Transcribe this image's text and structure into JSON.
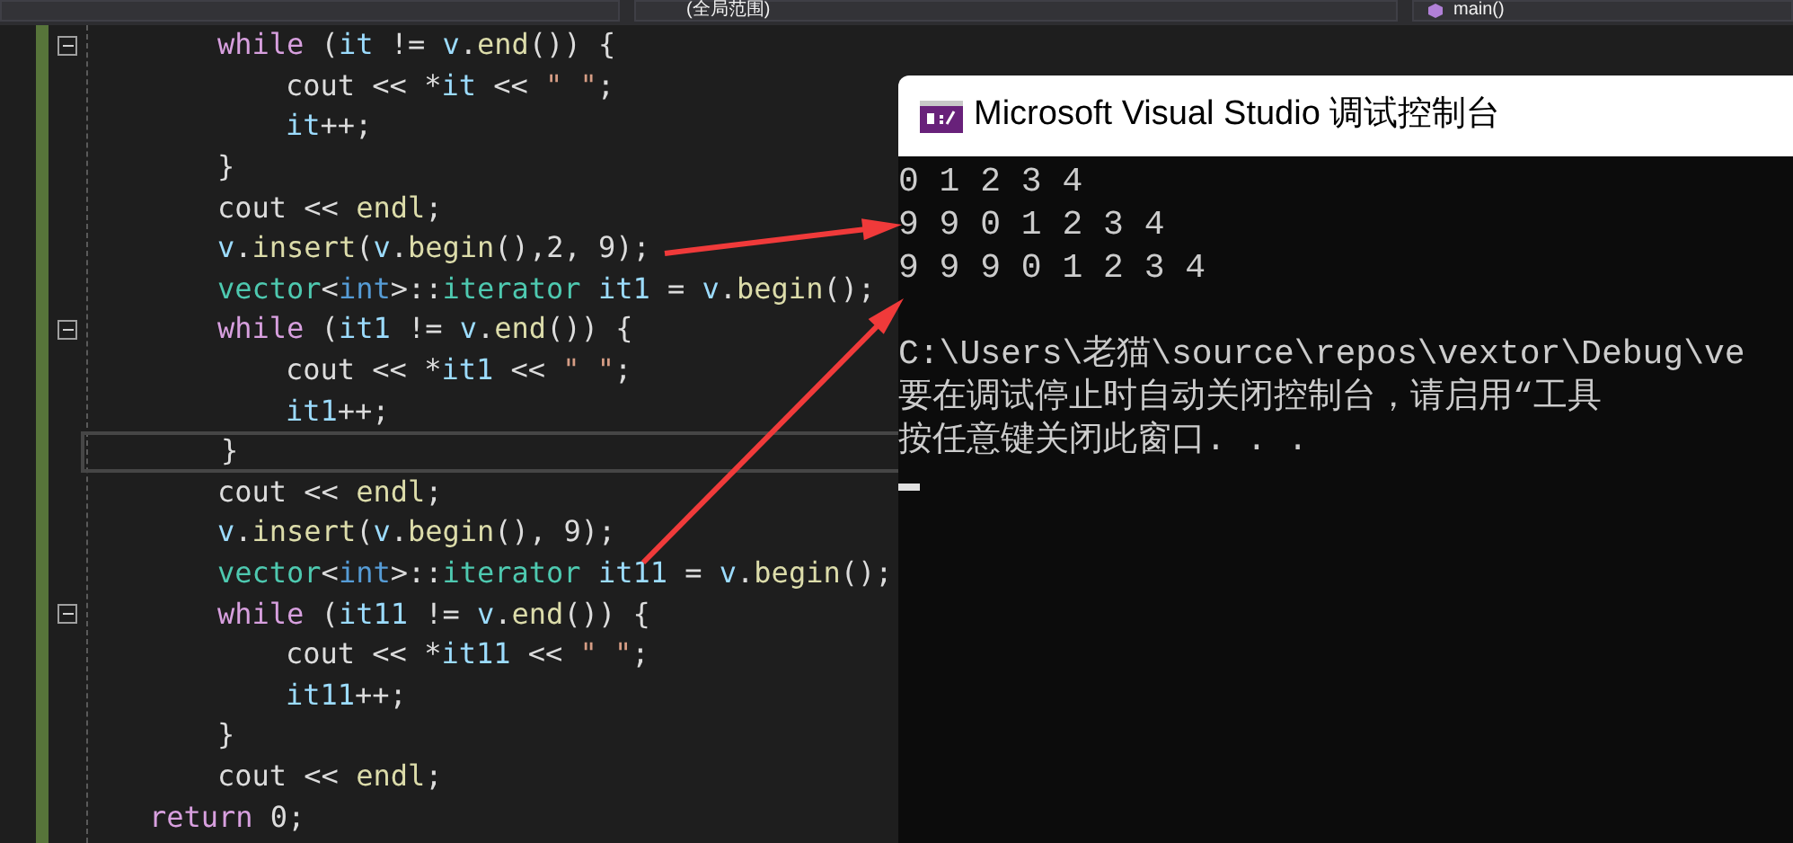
{
  "toolbar": {
    "scope_dropdown": "(全局范围)",
    "member_dropdown": "main()"
  },
  "code": {
    "lines": [
      {
        "children": [
          {
            "fold": true,
            "tokens": [
              {
                "kind": "keyword",
                "text": "while"
              },
              {
                "kind": "plain",
                "text": " ("
              },
              {
                "kind": "variable",
                "text": "it"
              },
              {
                "kind": "plain",
                "text": " != "
              },
              {
                "kind": "variable",
                "text": "v"
              },
              {
                "kind": "plain",
                "text": "."
              },
              {
                "kind": "function",
                "text": "end"
              },
              {
                "kind": "plain",
                "text": "()) {"
              }
            ],
            "children": [
              {
                "tokens": [
                  {
                    "kind": "plain",
                    "text": "cout << *"
                  },
                  {
                    "kind": "variable",
                    "text": "it"
                  },
                  {
                    "kind": "plain",
                    "text": " << "
                  },
                  {
                    "kind": "string",
                    "text": "\" \""
                  },
                  {
                    "kind": "plain",
                    "text": ";"
                  }
                ]
              },
              {
                "tokens": [
                  {
                    "kind": "variable",
                    "text": "it"
                  },
                  {
                    "kind": "plain",
                    "text": "++;"
                  }
                ]
              }
            ]
          },
          {
            "tokens": [
              {
                "kind": "plain",
                "text": "}"
              }
            ]
          },
          {
            "tokens": [
              {
                "kind": "plain",
                "text": "cout << "
              },
              {
                "kind": "function",
                "text": "endl"
              },
              {
                "kind": "plain",
                "text": ";"
              }
            ]
          },
          {
            "tokens": [
              {
                "kind": "variable",
                "text": "v"
              },
              {
                "kind": "plain",
                "text": "."
              },
              {
                "kind": "function",
                "text": "insert"
              },
              {
                "kind": "plain",
                "text": "("
              },
              {
                "kind": "variable",
                "text": "v"
              },
              {
                "kind": "plain",
                "text": "."
              },
              {
                "kind": "function",
                "text": "begin"
              },
              {
                "kind": "plain",
                "text": "(),2, 9);"
              }
            ]
          },
          {
            "tokens": [
              {
                "kind": "type",
                "text": "vector"
              },
              {
                "kind": "plain",
                "text": "<"
              },
              {
                "kind": "builtin",
                "text": "int"
              },
              {
                "kind": "plain",
                "text": ">::"
              },
              {
                "kind": "type",
                "text": "iterator"
              },
              {
                "kind": "variable",
                "text": " it1"
              },
              {
                "kind": "plain",
                "text": " = "
              },
              {
                "kind": "variable",
                "text": "v"
              },
              {
                "kind": "plain",
                "text": "."
              },
              {
                "kind": "function",
                "text": "begin"
              },
              {
                "kind": "plain",
                "text": "();"
              }
            ]
          },
          {
            "fold": true,
            "tokens": [
              {
                "kind": "keyword",
                "text": "while"
              },
              {
                "kind": "plain",
                "text": " ("
              },
              {
                "kind": "variable",
                "text": "it1"
              },
              {
                "kind": "plain",
                "text": " != "
              },
              {
                "kind": "variable",
                "text": "v"
              },
              {
                "kind": "plain",
                "text": "."
              },
              {
                "kind": "function",
                "text": "end"
              },
              {
                "kind": "plain",
                "text": "()) {"
              }
            ],
            "children": [
              {
                "tokens": [
                  {
                    "kind": "plain",
                    "text": "cout << *"
                  },
                  {
                    "kind": "variable",
                    "text": "it1"
                  },
                  {
                    "kind": "plain",
                    "text": " << "
                  },
                  {
                    "kind": "string",
                    "text": "\" \""
                  },
                  {
                    "kind": "plain",
                    "text": ";"
                  }
                ]
              },
              {
                "tokens": [
                  {
                    "kind": "variable",
                    "text": "it1"
                  },
                  {
                    "kind": "plain",
                    "text": "++;"
                  }
                ]
              }
            ]
          },
          {
            "current": true,
            "tokens": [
              {
                "kind": "plain",
                "text": "}"
              }
            ]
          },
          {
            "tokens": [
              {
                "kind": "plain",
                "text": "cout << "
              },
              {
                "kind": "function",
                "text": "endl"
              },
              {
                "kind": "plain",
                "text": ";"
              }
            ]
          },
          {
            "tokens": [
              {
                "kind": "variable",
                "text": "v"
              },
              {
                "kind": "plain",
                "text": "."
              },
              {
                "kind": "function",
                "text": "insert"
              },
              {
                "kind": "plain",
                "text": "("
              },
              {
                "kind": "variable",
                "text": "v"
              },
              {
                "kind": "plain",
                "text": "."
              },
              {
                "kind": "function",
                "text": "begin"
              },
              {
                "kind": "plain",
                "text": "(), 9);"
              }
            ]
          },
          {
            "tokens": [
              {
                "kind": "type",
                "text": "vector"
              },
              {
                "kind": "plain",
                "text": "<"
              },
              {
                "kind": "builtin",
                "text": "int"
              },
              {
                "kind": "plain",
                "text": ">::"
              },
              {
                "kind": "type",
                "text": "iterator"
              },
              {
                "kind": "variable",
                "text": " it11"
              },
              {
                "kind": "plain",
                "text": " = "
              },
              {
                "kind": "variable",
                "text": "v"
              },
              {
                "kind": "plain",
                "text": "."
              },
              {
                "kind": "function",
                "text": "begin"
              },
              {
                "kind": "plain",
                "text": "();"
              }
            ]
          },
          {
            "fold": true,
            "tokens": [
              {
                "kind": "keyword",
                "text": "while"
              },
              {
                "kind": "plain",
                "text": " ("
              },
              {
                "kind": "variable",
                "text": "it11"
              },
              {
                "kind": "plain",
                "text": " != "
              },
              {
                "kind": "variable",
                "text": "v"
              },
              {
                "kind": "plain",
                "text": "."
              },
              {
                "kind": "function",
                "text": "end"
              },
              {
                "kind": "plain",
                "text": "()) {"
              }
            ],
            "children": [
              {
                "tokens": [
                  {
                    "kind": "plain",
                    "text": "cout << *"
                  },
                  {
                    "kind": "variable",
                    "text": "it11"
                  },
                  {
                    "kind": "plain",
                    "text": " << "
                  },
                  {
                    "kind": "string",
                    "text": "\" \""
                  },
                  {
                    "kind": "plain",
                    "text": ";"
                  }
                ]
              },
              {
                "tokens": [
                  {
                    "kind": "variable",
                    "text": "it11"
                  },
                  {
                    "kind": "plain",
                    "text": "++;"
                  }
                ]
              }
            ]
          },
          {
            "tokens": [
              {
                "kind": "plain",
                "text": "}"
              }
            ]
          },
          {
            "tokens": [
              {
                "kind": "plain",
                "text": "cout << "
              },
              {
                "kind": "function",
                "text": "endl"
              },
              {
                "kind": "plain",
                "text": ";"
              }
            ]
          }
        ]
      },
      {
        "tokens": [
          {
            "kind": "keyword",
            "text": "return"
          },
          {
            "kind": "plain",
            "text": " 0;"
          }
        ]
      }
    ]
  },
  "console": {
    "title": "Microsoft Visual Studio 调试控制台",
    "output": [
      "0 1 2 3 4",
      "9 9 0 1 2 3 4",
      "9 9 9 0 1 2 3 4"
    ],
    "messages": [
      "C:\\Users\\老猫\\source\\repos\\vextor\\Debug\\ve",
      "要在调试停止时自动关闭控制台，请启用“工具",
      "按任意键关闭此窗口. . ."
    ],
    "cursor": true
  }
}
